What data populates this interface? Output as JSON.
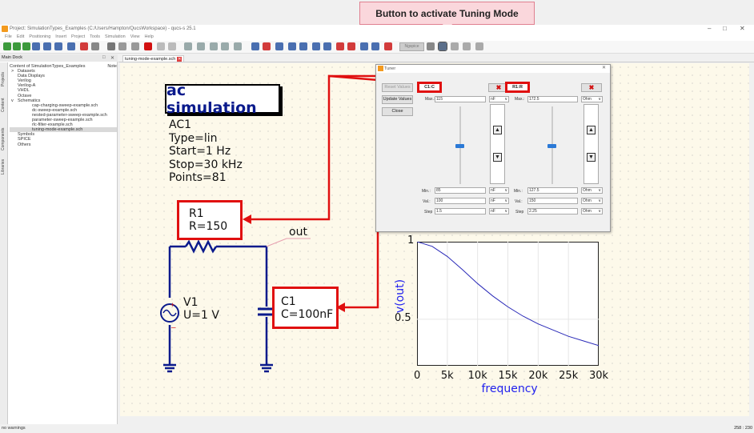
{
  "annotation": {
    "callout": "Button to activate Tuning Mode"
  },
  "window": {
    "title": "Project: SimulationTypes_Examples (C:/Users/Hampton/QucsWorkspace) - qucs-s 25.1",
    "min": "–",
    "restore": "□",
    "close": "✕"
  },
  "menu": [
    "File",
    "Edit",
    "Positioning",
    "Insert",
    "Project",
    "Tools",
    "Simulation",
    "View",
    "Help"
  ],
  "toolbar": {
    "simulator_label": "Ngspice"
  },
  "dock": {
    "title": "Main Dock",
    "side_tabs": [
      "Projects",
      "Content",
      "Components",
      "Libraries"
    ],
    "tree_header": "Content of SimulationTypes_Examples",
    "tree_note": "Note",
    "items": [
      {
        "label": "Datasets",
        "indent": 1,
        "arrow": ">"
      },
      {
        "label": "Data Displays",
        "indent": 1
      },
      {
        "label": "Verilog",
        "indent": 1
      },
      {
        "label": "Verilog-A",
        "indent": 1
      },
      {
        "label": "VHDL",
        "indent": 1
      },
      {
        "label": "Octave",
        "indent": 1
      },
      {
        "label": "Schematics",
        "indent": 1,
        "arrow": "v"
      },
      {
        "label": "cap-charging-sweep-example.sch",
        "indent": 2
      },
      {
        "label": "dc-sweep-example.sch",
        "indent": 2
      },
      {
        "label": "nested-parameter-sweep-example.sch",
        "indent": 2
      },
      {
        "label": "parameter-sweep-example.sch",
        "indent": 2
      },
      {
        "label": "rlc-filter-example.sch",
        "indent": 2
      },
      {
        "label": "tuning-mode-example.sch",
        "indent": 2,
        "selected": true
      },
      {
        "label": "Symbols",
        "indent": 1
      },
      {
        "label": "SPICE",
        "indent": 1
      },
      {
        "label": "Others",
        "indent": 1
      }
    ]
  },
  "doc_tab": {
    "label": "tuning-mode-example.sch"
  },
  "schematic": {
    "sim_title": "ac simulation",
    "sim_params": [
      "AC1",
      "Type=lin",
      "Start=1 Hz",
      "Stop=30 kHz",
      "Points=81"
    ],
    "r1": [
      "R1",
      "R=150"
    ],
    "c1": [
      "C1",
      "C=100nF"
    ],
    "v1": [
      "V1",
      "U=1 V"
    ],
    "net_label": "out"
  },
  "tuner": {
    "title": "Tuner",
    "buttons": {
      "reset": "Reset Values",
      "update": "Update Values",
      "close": "Close"
    },
    "columns": [
      {
        "name": "C1:C",
        "max_label": "Max.:",
        "max": "115",
        "unit": "nF",
        "min_label": "Min.:",
        "min": "85",
        "val_label": "Val.:",
        "val": "100",
        "step_label": "Step",
        "step": "1.5",
        "slider_pos": 0.5
      },
      {
        "name": "R1:R",
        "max_label": "Max.:",
        "max": "172.5",
        "unit": "Ohm",
        "min_label": "Min.:",
        "min": "127.5",
        "val_label": "Val.:",
        "val": "150",
        "step_label": "Step",
        "step": "2.25",
        "slider_pos": 0.5
      }
    ]
  },
  "chart_data": {
    "type": "line",
    "xlabel": "frequency",
    "ylabel": "v(out)",
    "xlim": [
      0,
      30000
    ],
    "ylim": [
      0.2,
      1.0
    ],
    "xticks": [
      "0",
      "5k",
      "10k",
      "15k",
      "20k",
      "25k",
      "30k"
    ],
    "yticks": [
      "1",
      "0.5"
    ],
    "grid": true,
    "series": [
      {
        "color": "#2a2ab8",
        "x": [
          0,
          2500,
          5000,
          7500,
          10000,
          12500,
          15000,
          17500,
          20000,
          22500,
          25000,
          27500,
          30000
        ],
        "y": [
          1.0,
          0.97,
          0.905,
          0.82,
          0.73,
          0.65,
          0.58,
          0.52,
          0.47,
          0.43,
          0.39,
          0.36,
          0.33
        ]
      }
    ]
  },
  "status": {
    "left": "no warnings",
    "right": "258 : 230"
  },
  "colors": {
    "accent_red": "#e01010",
    "wire": "#0a1a8c",
    "canvas": "#fdf9ea"
  }
}
